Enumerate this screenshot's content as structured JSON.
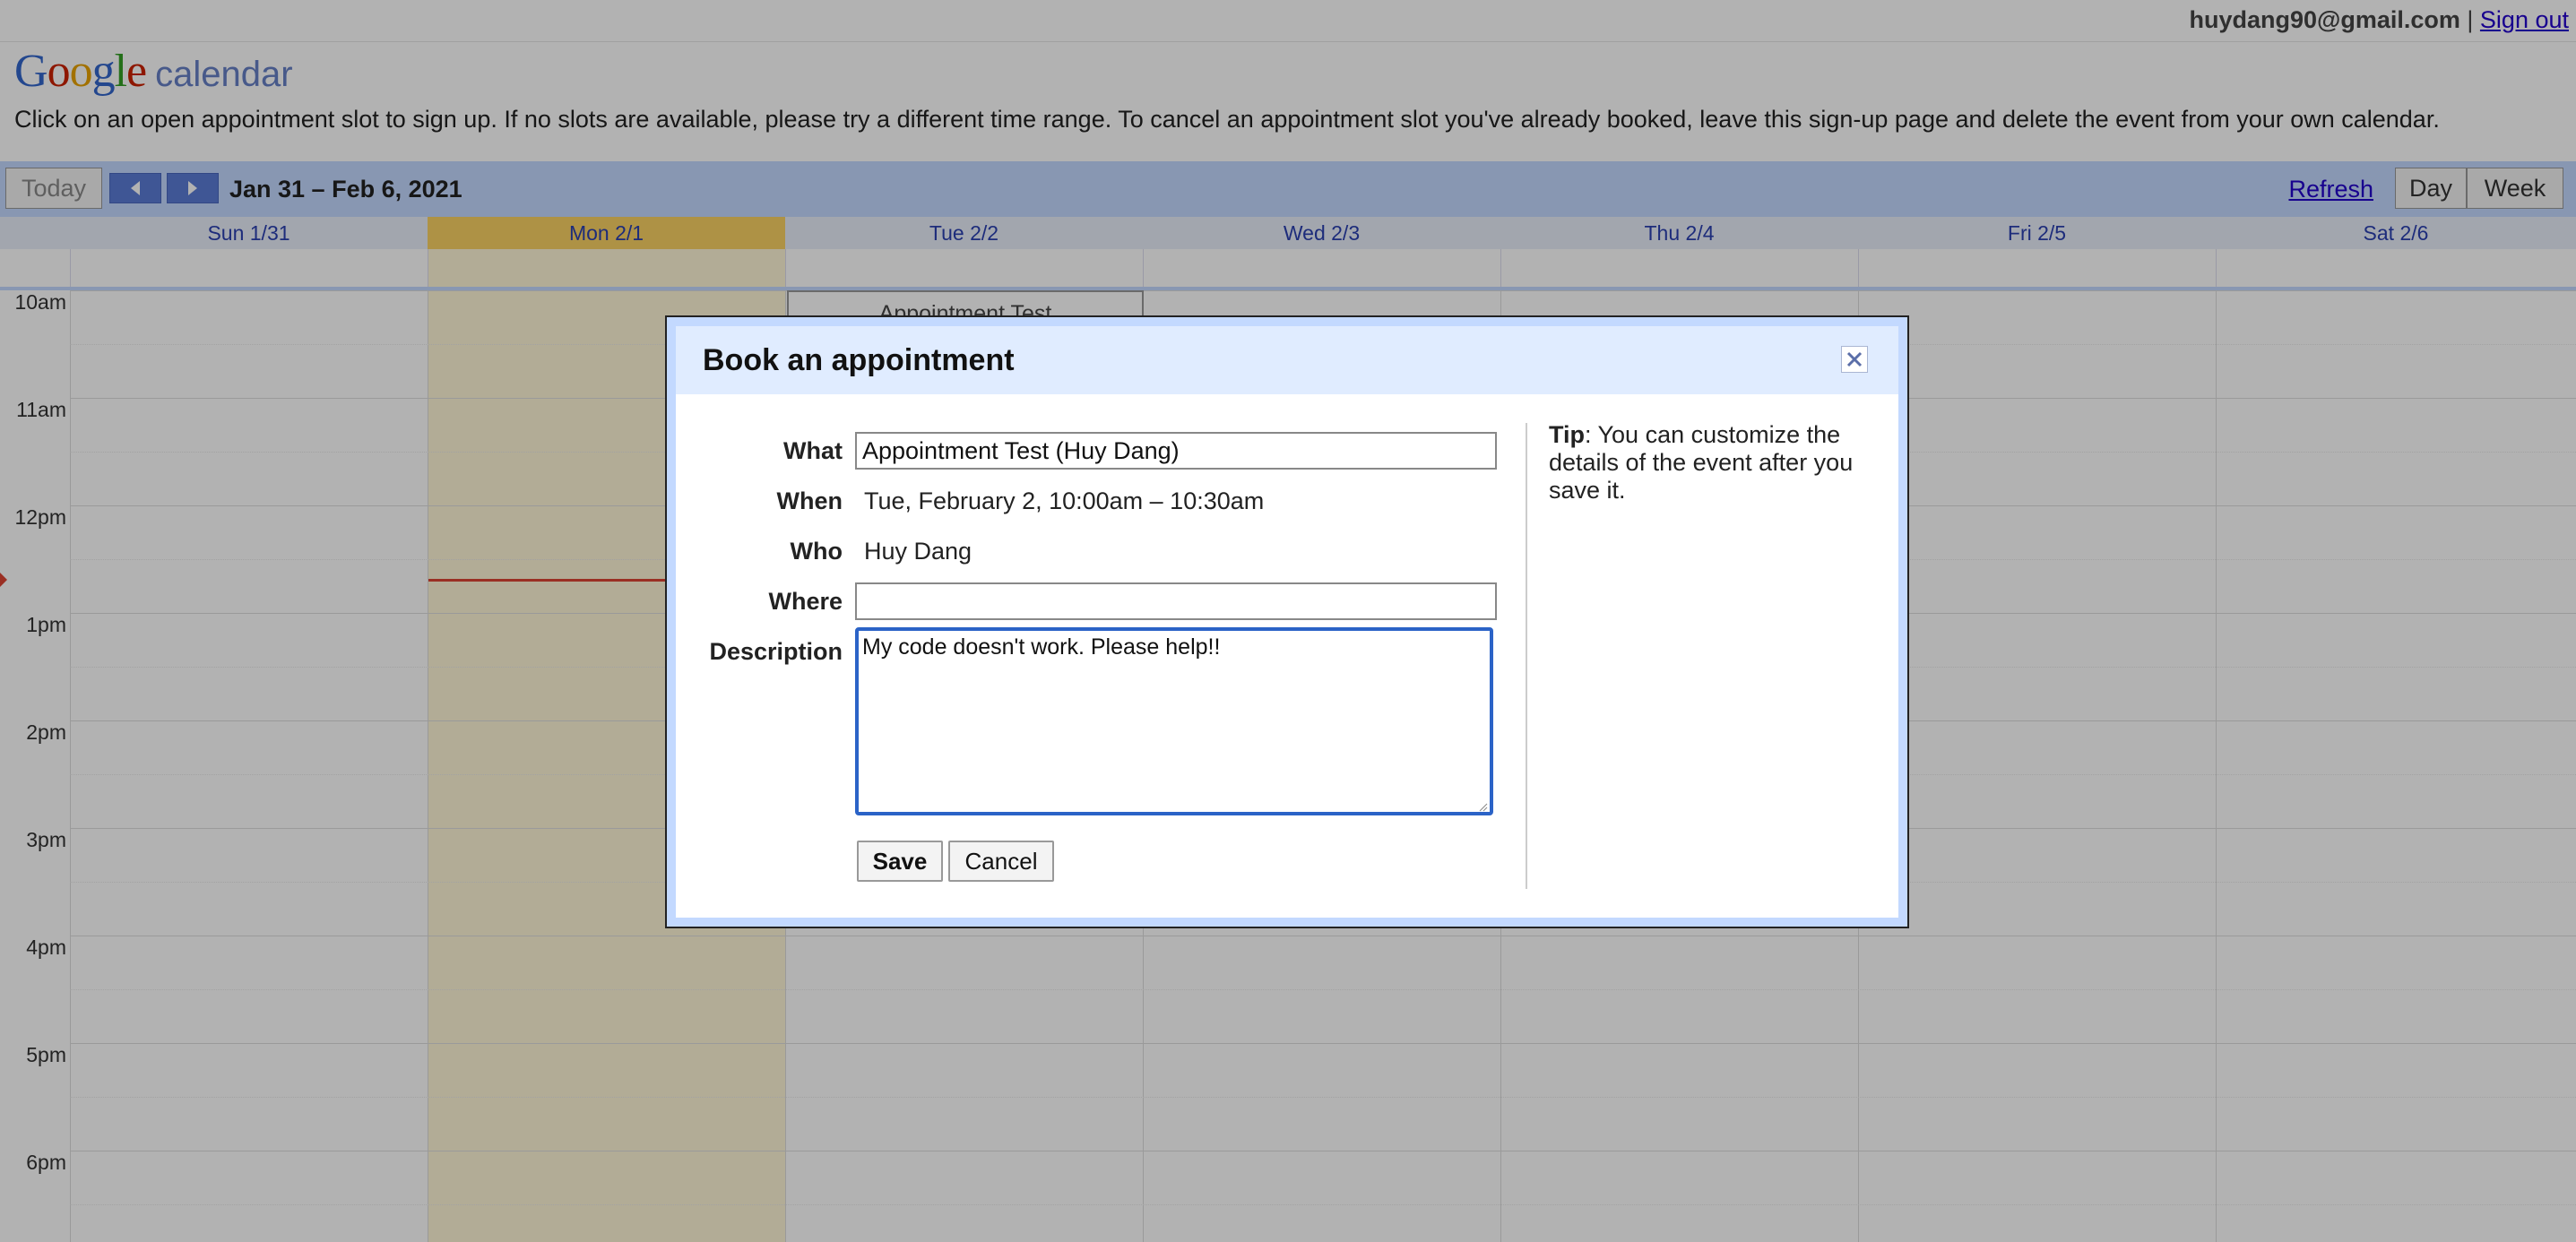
{
  "account": {
    "email": "huydang90@gmail.com",
    "separator": "|",
    "signout_label": "Sign out"
  },
  "brand": {
    "logo_google": [
      "G",
      "o",
      "o",
      "g",
      "l",
      "e"
    ],
    "logo_calendar": "calendar"
  },
  "instructions": "Click on an open appointment slot to sign up. If no slots are available, please try a different time range. To cancel an appointment slot you've already booked, leave this sign-up page and delete the event from your own calendar.",
  "toolbar": {
    "today_label": "Today",
    "prev_icon": "chevron-left-icon",
    "next_icon": "chevron-right-icon",
    "date_range": "Jan 31 – Feb 6, 2021",
    "refresh_label": "Refresh",
    "day_label": "Day",
    "week_label": "Week"
  },
  "days": [
    {
      "label": "Sun 1/31",
      "today": false
    },
    {
      "label": "Mon 2/1",
      "today": true
    },
    {
      "label": "Tue 2/2",
      "today": false
    },
    {
      "label": "Wed 2/3",
      "today": false
    },
    {
      "label": "Thu 2/4",
      "today": false
    },
    {
      "label": "Fri 2/5",
      "today": false
    },
    {
      "label": "Sat 2/6",
      "today": false
    }
  ],
  "hours": [
    "10am",
    "11am",
    "12pm",
    "1pm",
    "2pm",
    "3pm",
    "4pm",
    "5pm",
    "6pm"
  ],
  "event": {
    "title": "Appointment Test"
  },
  "modal": {
    "title": "Book an appointment",
    "close_icon": "close-icon",
    "what_label": "What",
    "what_value": "Appointment Test (Huy Dang)",
    "when_label": "When",
    "when_value": "Tue, February 2, 10:00am – 10:30am",
    "who_label": "Who",
    "who_value": "Huy Dang",
    "where_label": "Where",
    "where_value": "",
    "description_label": "Description",
    "description_value": "My code doesn't work. Please help!!",
    "save_label": "Save",
    "cancel_label": "Cancel",
    "tip_label": "Tip",
    "tip_text": ": You can customize the details of the event after you save it."
  },
  "colors": {
    "accent": "#c3d9ff",
    "today_header": "#fad163",
    "today_column": "#fff7d7",
    "now_line": "#dd4433",
    "link": "#2200cc"
  }
}
